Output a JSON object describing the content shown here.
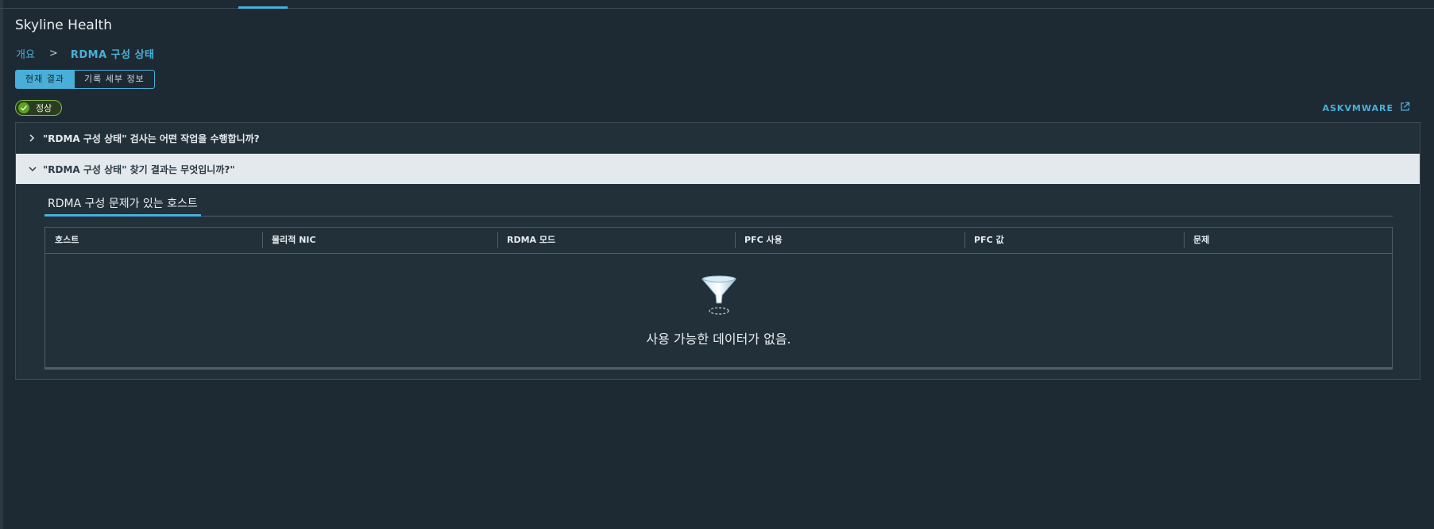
{
  "app": {
    "title": "Skyline Health"
  },
  "breadcrumb": {
    "overview": "개요",
    "separator": ">",
    "current": "RDMA 구성 상태"
  },
  "view_toggle": {
    "current": "현재 결과",
    "history": "기록 세부 정보"
  },
  "status": {
    "label": "정상",
    "color": "#5aa220"
  },
  "external_link": {
    "label": "ASKVMWARE"
  },
  "accordion": {
    "panel1_title": "\"RDMA 구성 상태\" 검사는 어떤 작업을 수행합니까?",
    "panel2_title": "\"RDMA 구성 상태\" 찾기 결과는 무엇입니까?\""
  },
  "results": {
    "tab_label": "RDMA 구성 문제가 있는 호스트",
    "columns": [
      "호스트",
      "물리적 NIC",
      "RDMA 모드",
      "PFC 사용",
      "PFC 값",
      "문제"
    ],
    "empty_message": "사용 가능한 데이터가 없음."
  },
  "colors": {
    "accent": "#49afd9",
    "background": "#1e2a33",
    "panel": "#22303a",
    "open_header": "#e3e9ed",
    "ok_green": "#5aa220"
  }
}
